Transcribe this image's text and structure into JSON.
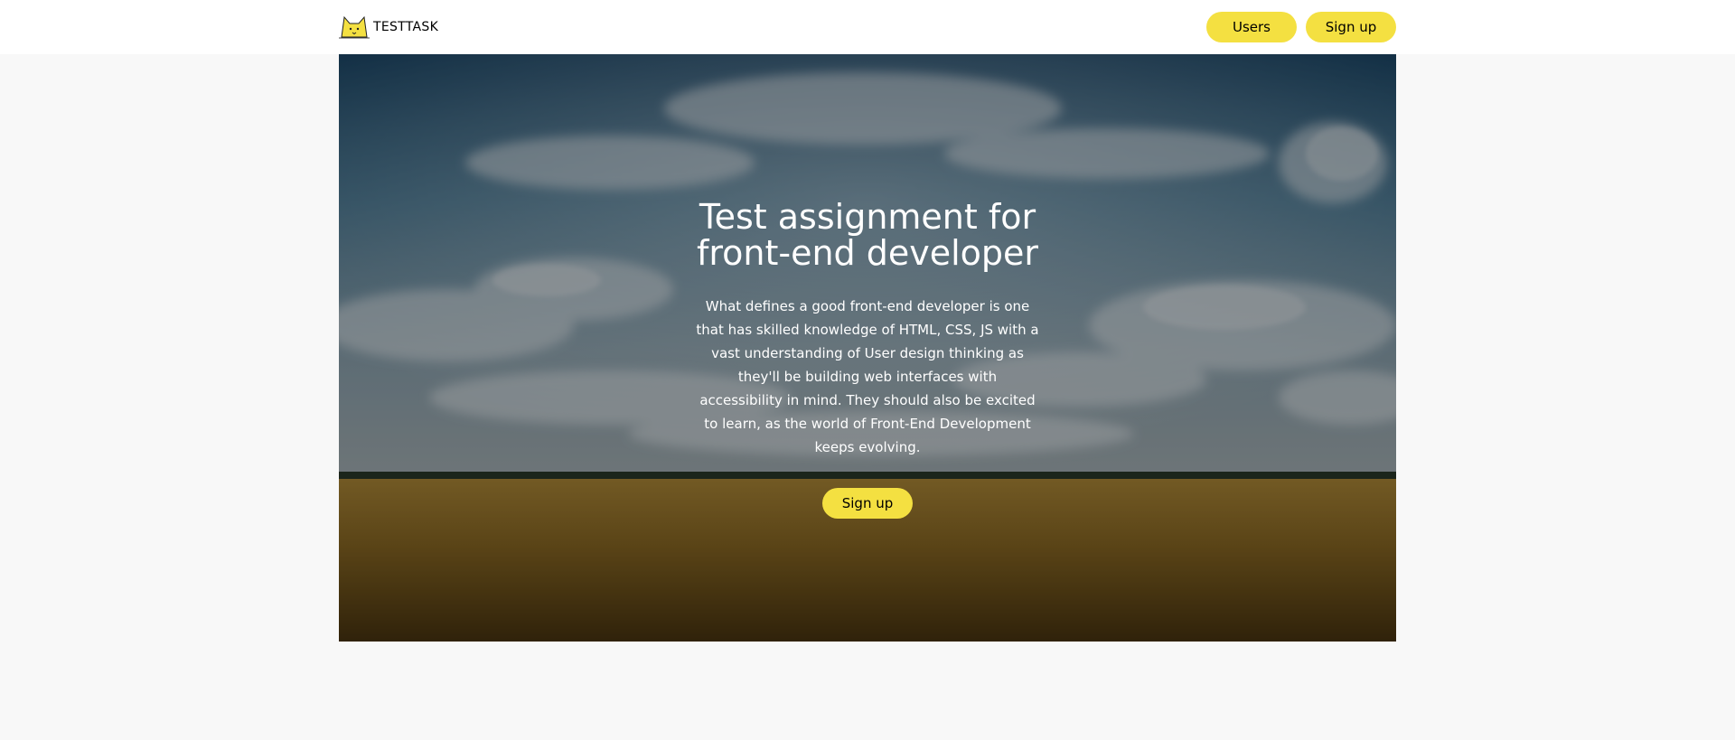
{
  "header": {
    "logo_text": "TESTTASK",
    "logo_icon": "cat-icon",
    "nav": {
      "users_label": "Users",
      "signup_label": "Sign up"
    }
  },
  "hero": {
    "title": "Test assignment for front-end developer",
    "description": "What defines a good front-end developer is one that has skilled knowledge of HTML, CSS, JS with a vast understanding of User design thinking as they'll be building web interfaces with accessibility in mind. They should also be excited to learn, as the world of Front-End Development keeps evolving.",
    "cta_label": "Sign up"
  },
  "colors": {
    "accent": "#f4e041",
    "page_background": "#f8f8f8",
    "header_background": "#ffffff"
  }
}
